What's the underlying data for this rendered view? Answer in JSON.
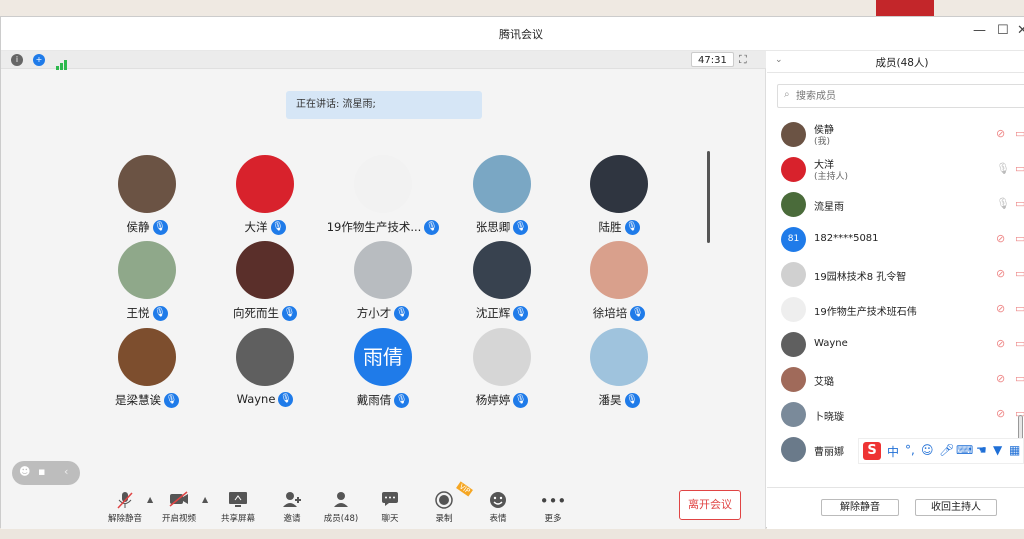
{
  "window": {
    "title": "腾讯会议"
  },
  "stage": {
    "timer": "47:31",
    "speaking": "正在讲话: 流星雨;",
    "participants": [
      {
        "name": "侯静",
        "avatar_color": "#6b5344",
        "avatar_text": ""
      },
      {
        "name": "大洋",
        "avatar_color": "#d8222c",
        "avatar_text": "",
        "host": true
      },
      {
        "name": "19作物生产技术...",
        "avatar_color": "#f2f2f2",
        "avatar_text": ""
      },
      {
        "name": "张思卿",
        "avatar_color": "#7aa7c4",
        "avatar_text": ""
      },
      {
        "name": "陆胜",
        "avatar_color": "#2f3540",
        "avatar_text": ""
      },
      {
        "name": "王悦",
        "avatar_color": "#8fa88a",
        "avatar_text": ""
      },
      {
        "name": "向死而生",
        "avatar_color": "#5a2f2a",
        "avatar_text": ""
      },
      {
        "name": "方小才",
        "avatar_color": "#b8bcc0",
        "avatar_text": ""
      },
      {
        "name": "沈正辉",
        "avatar_color": "#38424f",
        "avatar_text": ""
      },
      {
        "name": "徐培培",
        "avatar_color": "#d9a08c",
        "avatar_text": ""
      },
      {
        "name": "是梁慧诶",
        "avatar_color": "#7d4e2e",
        "avatar_text": ""
      },
      {
        "name": "Wayne",
        "avatar_color": "#5f5f5f",
        "avatar_text": ""
      },
      {
        "name": "戴雨倩",
        "avatar_color": "#1f7be9",
        "avatar_text": "雨倩"
      },
      {
        "name": "杨婷婷",
        "avatar_color": "#d6d6d6",
        "avatar_text": ""
      },
      {
        "name": "潘昊",
        "avatar_color": "#9fc3dd",
        "avatar_text": ""
      }
    ]
  },
  "toolbar": {
    "unmute": "解除静音",
    "video": "开启视频",
    "share": "共享屏幕",
    "invite": "邀请",
    "members": "成员(48)",
    "chat": "聊天",
    "record": "录制",
    "emoji": "表情",
    "more": "更多",
    "leave": "离开会议"
  },
  "panel": {
    "title": "成员(48人)",
    "search_placeholder": "搜索成员",
    "members": [
      {
        "name": "侯静",
        "role": "(我)",
        "avatar_color": "#6b5344",
        "avatar_text": "",
        "mic_muted": true
      },
      {
        "name": "大洋",
        "role": "(主持人)",
        "avatar_color": "#d8222c",
        "avatar_text": "",
        "mic_muted": false
      },
      {
        "name": "流星雨",
        "role": "",
        "avatar_color": "#4a6b3a",
        "avatar_text": "",
        "mic_muted": false
      },
      {
        "name": "182****5081",
        "role": "",
        "avatar_color": "#1f7be9",
        "avatar_text": "81",
        "mic_muted": true
      },
      {
        "name": "19园林技术8 孔令智",
        "role": "",
        "avatar_color": "#d0d0d0",
        "avatar_text": "",
        "mic_muted": true
      },
      {
        "name": "19作物生产技术班石伟",
        "role": "",
        "avatar_color": "#eeeeee",
        "avatar_text": "",
        "mic_muted": true
      },
      {
        "name": "Wayne",
        "role": "",
        "avatar_color": "#5f5f5f",
        "avatar_text": "",
        "mic_muted": true
      },
      {
        "name": "艾璐",
        "role": "",
        "avatar_color": "#a06a5a",
        "avatar_text": "",
        "mic_muted": true
      },
      {
        "name": "卜晓璇",
        "role": "",
        "avatar_color": "#7a8a9a",
        "avatar_text": "",
        "mic_muted": true
      },
      {
        "name": "曹丽娜",
        "role": "",
        "avatar_color": "#6a7a8a",
        "avatar_text": "",
        "mic_muted": true
      }
    ],
    "unmute_all": "解除静音",
    "reclaim_host": "收回主持人"
  },
  "ime": {
    "lang": "中"
  }
}
